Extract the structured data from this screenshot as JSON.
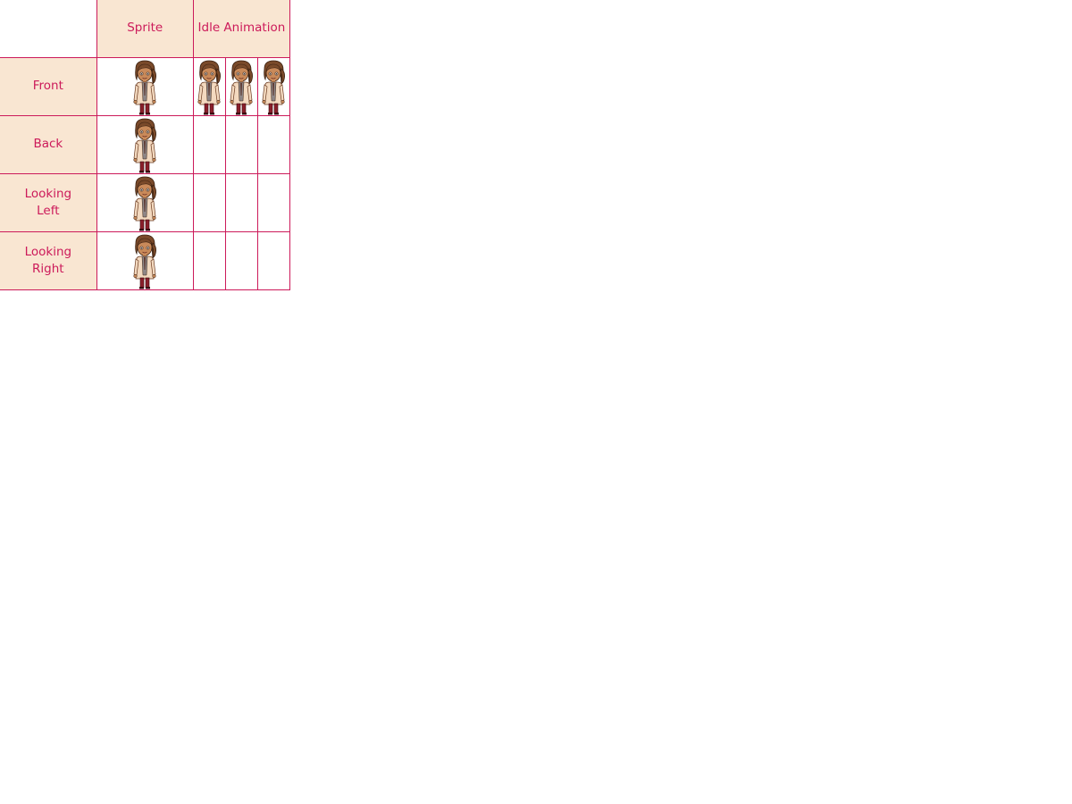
{
  "header": {
    "sprite_label": "Sprite",
    "idle_label": "Idle Animation"
  },
  "rows": [
    {
      "label": "Front",
      "frames": 4
    },
    {
      "label": "Back",
      "frames": 1
    },
    {
      "label": "Looking\nLeft",
      "frames": 1
    },
    {
      "label": "Looking\nRight",
      "frames": 1
    }
  ],
  "colors": {
    "accent": "#cc1a5a",
    "header_fill": "#f9e6d2",
    "skin": "#c98a5a",
    "hair": "#7a4a2a",
    "coat": "#f3d9bf",
    "pants": "#8a1f2a"
  }
}
